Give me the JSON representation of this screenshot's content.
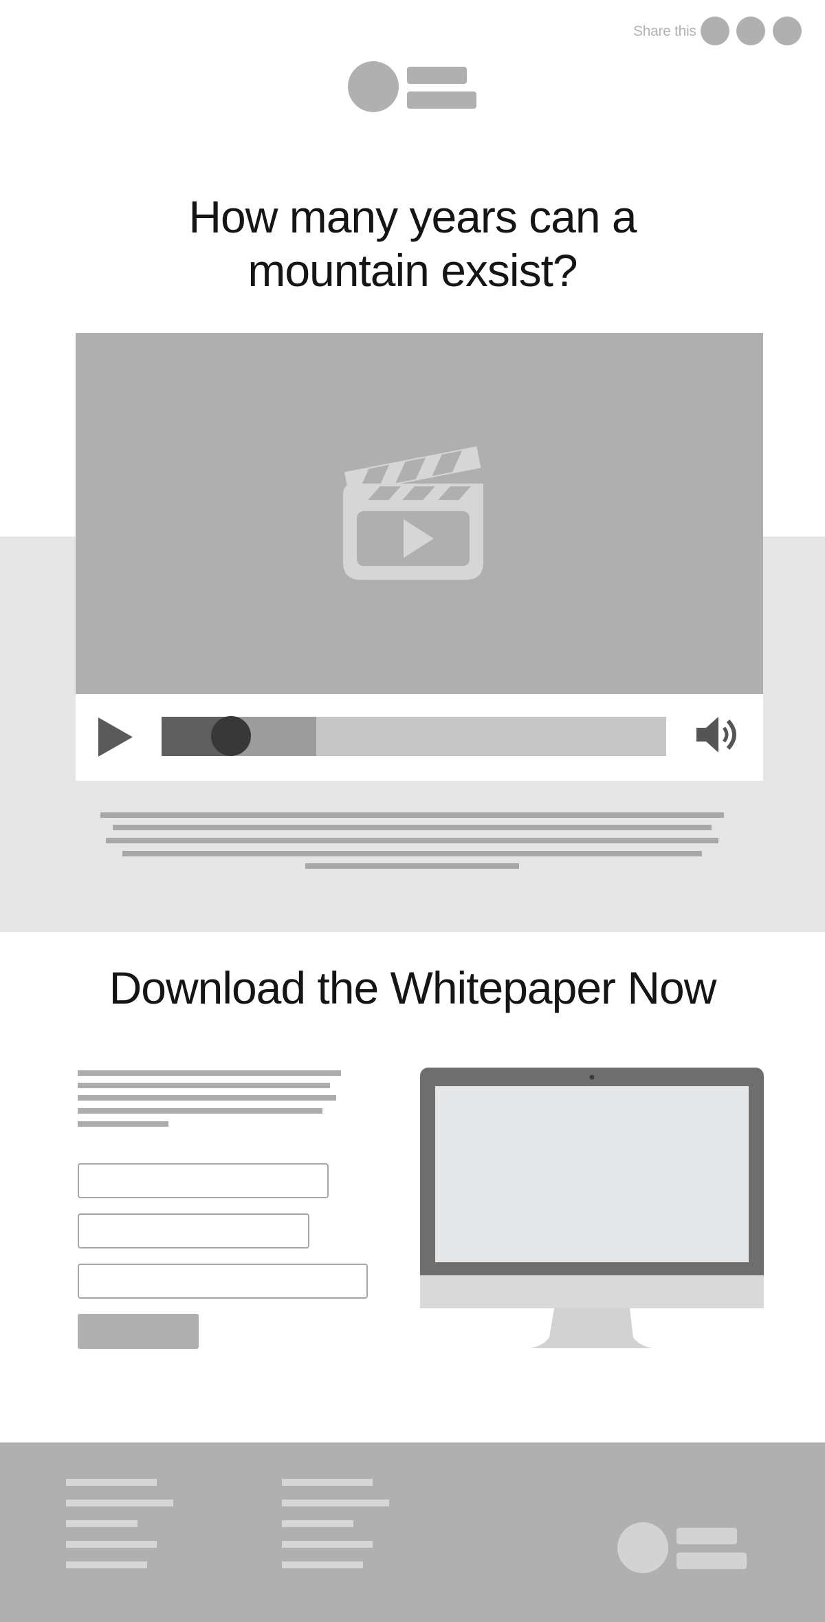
{
  "header": {
    "share_label": "Share this",
    "share_icons": [
      "share-icon-1",
      "share-icon-2",
      "share-icon-3"
    ],
    "logo": "site-logo"
  },
  "hero": {
    "title": "How many years can a\nmountain exsist?"
  },
  "video": {
    "placeholder_icon": "film-clapper-icon",
    "controls": {
      "play_icon": "play-icon",
      "volume_icon": "volume-icon",
      "played_fraction": 0.138,
      "buffered_fraction": 0.307
    }
  },
  "whitepaper": {
    "title": "Download the Whitepaper Now",
    "form_fields": [
      "name-field",
      "email-field",
      "company-field"
    ],
    "submit_icon": "submit-button",
    "illustration": "desktop-monitor-icon"
  },
  "footer": {
    "columns": 2,
    "logo": "footer-logo"
  },
  "colors": {
    "placeholder": "#b0b0b0",
    "band": "#e5e5e5",
    "footer": "#b0b0b0",
    "text": "#151515"
  }
}
